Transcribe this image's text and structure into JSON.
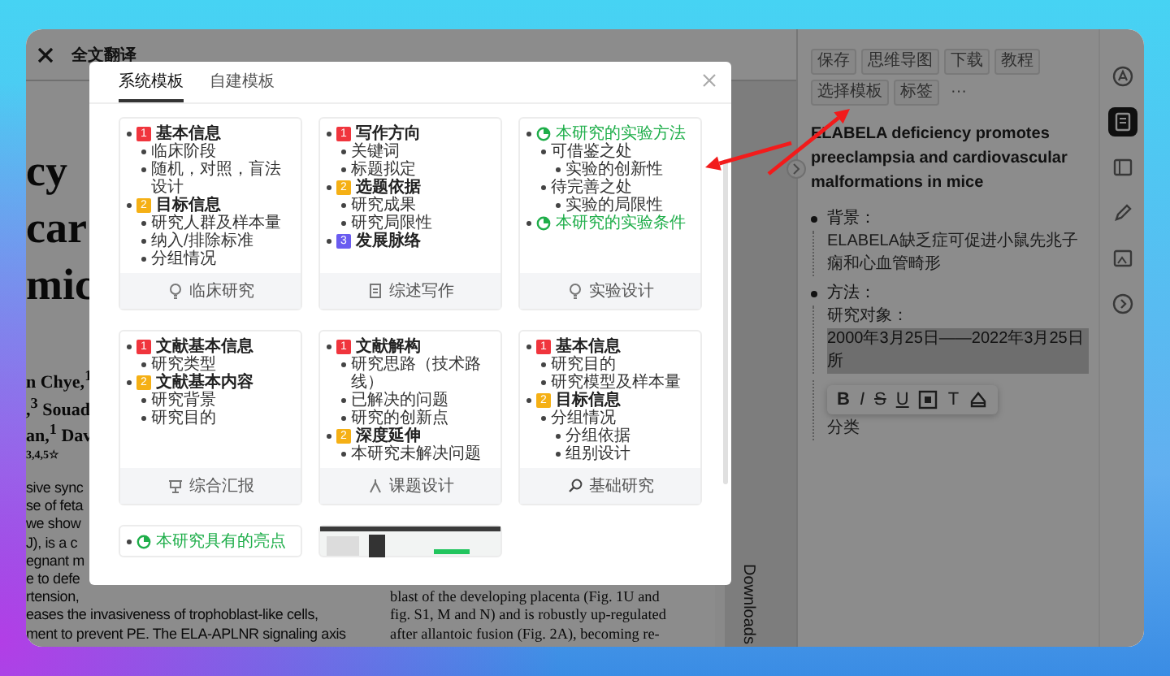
{
  "pdf_viewer": {
    "toolbar": {
      "title": "全文翻译"
    },
    "left_column": {
      "title_lines": [
        "cy",
        "car",
        "mic"
      ],
      "author_lines": [
        "n Chye,$^{1}$",
        ",$^{3}$ Souad",
        "an,$^{1}$ Dav"
      ],
      "affiliation_marks": "3,4,5☆",
      "abstract_lines": [
        "sive sync",
        "se of feta",
        "we show",
        "J), is a c",
        "egnant m",
        "e to defe",
        "rtension,",
        "eases the invasiveness of trophoblast-like cells,",
        "ment to prevent PE. The ELA-APLNR signaling axis"
      ]
    },
    "right_column": {
      "lines": [
        "blast of the developing placenta (Fig. 1U and",
        "fig. S1, M and N) and is robustly up-regulated",
        "after allantoic fusion (Fig. 2A), becoming re-"
      ]
    },
    "side_label": "Downloads"
  },
  "note_panel": {
    "toolbar": [
      "保存",
      "思维导图",
      "下载",
      "教程",
      "选择模板",
      "标签"
    ],
    "more": "···",
    "title": "ELABELA deficiency promotes preeclampsia and cardiovascular malformations in mice",
    "outline": [
      {
        "text": "背景：",
        "children": [
          {
            "text": "ELABELA缺乏症可促进小鼠先兆子痫和心血管畸形"
          }
        ]
      },
      {
        "text": "方法：",
        "children": [
          {
            "text": "研究对象：",
            "selected_text": "2000年3月25日——2022年3月25日所"
          }
        ]
      }
    ],
    "format_toolbar": [
      {
        "kind": "bold",
        "text": "B"
      },
      {
        "kind": "italic",
        "text": "I"
      },
      {
        "kind": "strike",
        "text": "S"
      },
      {
        "kind": "underline",
        "text": "U"
      },
      {
        "kind": "boxed"
      },
      {
        "kind": "plain",
        "text": "T"
      },
      {
        "kind": "bucket"
      }
    ],
    "after_toolbar": "分类"
  },
  "icon_rail": [
    {
      "selected": false
    },
    {
      "selected": true
    },
    {
      "selected": false
    },
    {
      "selected": false
    },
    {
      "selected": false
    },
    {
      "selected": false
    }
  ],
  "modal": {
    "tabs": [
      {
        "label": "系统模板",
        "selected": true
      },
      {
        "label": "自建模板",
        "selected": false
      }
    ],
    "cards": [
      {
        "kind": "outline",
        "label": "临床研究",
        "outline": [
          {
            "kind": "numbered",
            "badge": "1",
            "color": "#f0353d",
            "text": "基本信息",
            "children": [
              {
                "text": "临床阶段"
              },
              {
                "text": "随机，对照，盲法设计"
              }
            ]
          },
          {
            "kind": "numbered",
            "badge": "2",
            "color": "#f5b015",
            "text": "目标信息",
            "children": [
              {
                "text": "研究人群及样本量"
              },
              {
                "text": "纳入/排除标准"
              },
              {
                "text": "分组情况"
              }
            ]
          }
        ]
      },
      {
        "kind": "outline",
        "label": "综述写作",
        "outline": [
          {
            "kind": "numbered",
            "badge": "1",
            "color": "#f0353d",
            "text": "写作方向",
            "children": [
              {
                "text": "关键词"
              },
              {
                "text": "标题拟定"
              }
            ]
          },
          {
            "kind": "numbered",
            "badge": "2",
            "color": "#f5b015",
            "text": "选题依据",
            "children": [
              {
                "text": "研究成果"
              },
              {
                "text": "研究局限性"
              }
            ]
          },
          {
            "kind": "numbered",
            "badge": "3",
            "color": "#6a5cf0",
            "text": "发展脉络"
          }
        ]
      },
      {
        "kind": "outline",
        "label": "实验设计",
        "outline": [
          {
            "kind": "milestone",
            "text": "本研究的实验方法",
            "children": [
              {
                "text": "可借鉴之处",
                "children": [
                  {
                    "text": "实验的创新性"
                  }
                ]
              },
              {
                "text": "待完善之处",
                "children": [
                  {
                    "text": "实验的局限性"
                  }
                ]
              }
            ]
          },
          {
            "kind": "milestone",
            "text": "本研究的实验条件"
          }
        ]
      },
      {
        "kind": "outline",
        "label": "综合汇报",
        "outline": [
          {
            "kind": "numbered",
            "badge": "1",
            "color": "#f0353d",
            "text": "文献基本信息",
            "children": [
              {
                "text": "研究类型"
              }
            ]
          },
          {
            "kind": "numbered",
            "badge": "2",
            "color": "#f5b015",
            "text": "文献基本内容",
            "children": [
              {
                "text": "研究背景"
              },
              {
                "text": "研究目的"
              }
            ]
          }
        ]
      },
      {
        "kind": "outline",
        "label": "课题设计",
        "outline": [
          {
            "kind": "numbered",
            "badge": "1",
            "color": "#f0353d",
            "text": "文献解构",
            "children": [
              {
                "text": "研究思路（技术路线）"
              },
              {
                "text": "已解决的问题"
              },
              {
                "text": "研究的创新点"
              }
            ]
          },
          {
            "kind": "numbered",
            "badge": "2",
            "color": "#f5b015",
            "text": "深度延伸",
            "children": [
              {
                "text": "本研究未解决问题"
              }
            ]
          }
        ]
      },
      {
        "kind": "outline",
        "label": "基础研究",
        "outline": [
          {
            "kind": "numbered",
            "badge": "1",
            "color": "#f0353d",
            "text": "基本信息",
            "children": [
              {
                "text": "研究目的"
              },
              {
                "text": "研究模型及样本量"
              }
            ]
          },
          {
            "kind": "numbered",
            "badge": "2",
            "color": "#f5b015",
            "text": "目标信息",
            "children": [
              {
                "text": "分组情况",
                "children": [
                  {
                    "text": "分组依据"
                  },
                  {
                    "text": "组别设计"
                  }
                ]
              }
            ]
          }
        ]
      },
      {
        "kind": "peek",
        "outline": [
          {
            "kind": "milestone",
            "text": "本研究具有的亮点"
          }
        ]
      },
      {
        "kind": "screenshot"
      }
    ]
  }
}
